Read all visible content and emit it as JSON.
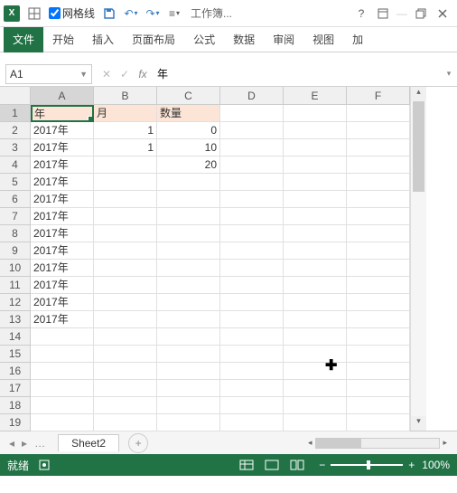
{
  "titlebar": {
    "gridlines_label": "网格线",
    "gridlines_checked": true,
    "title": "工作簿..."
  },
  "ribbon": {
    "file": "文件",
    "tabs": [
      "开始",
      "插入",
      "页面布局",
      "公式",
      "数据",
      "审阅",
      "视图",
      "加"
    ]
  },
  "namebox": "A1",
  "formula_value": "年",
  "columns": [
    "A",
    "B",
    "C",
    "D",
    "E",
    "F"
  ],
  "rows": [
    {
      "n": "1",
      "A": "年",
      "B": "月",
      "C": "数量",
      "hdr": true
    },
    {
      "n": "2",
      "A": "2017年",
      "B": "1",
      "C": "0"
    },
    {
      "n": "3",
      "A": "2017年",
      "B": "1",
      "C": "10"
    },
    {
      "n": "4",
      "A": "2017年",
      "B": "",
      "C": "20"
    },
    {
      "n": "5",
      "A": "2017年"
    },
    {
      "n": "6",
      "A": "2017年"
    },
    {
      "n": "7",
      "A": "2017年"
    },
    {
      "n": "8",
      "A": "2017年"
    },
    {
      "n": "9",
      "A": "2017年"
    },
    {
      "n": "10",
      "A": "2017年"
    },
    {
      "n": "11",
      "A": "2017年"
    },
    {
      "n": "12",
      "A": "2017年"
    },
    {
      "n": "13",
      "A": "2017年"
    },
    {
      "n": "14"
    },
    {
      "n": "15"
    },
    {
      "n": "16"
    },
    {
      "n": "17"
    },
    {
      "n": "18"
    },
    {
      "n": "19"
    }
  ],
  "sheet": {
    "active": "Sheet2"
  },
  "status": {
    "ready": "就绪",
    "zoom": "100%"
  }
}
